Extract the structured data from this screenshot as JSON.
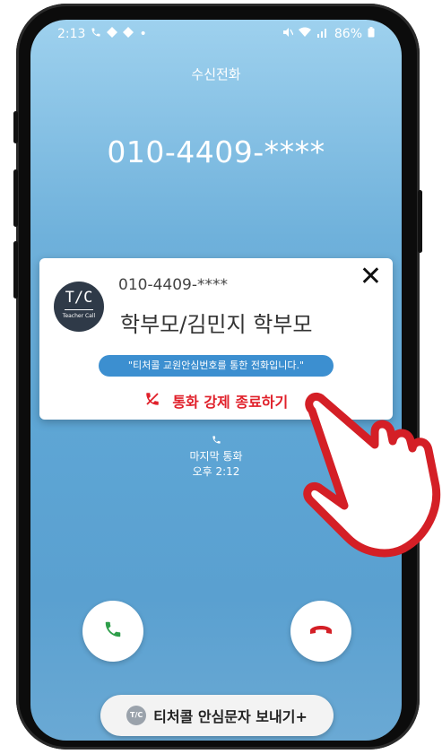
{
  "status_bar": {
    "time": "2:13",
    "left_icons": [
      "phone-icon",
      "diamond-icon",
      "diamond-icon",
      "dot"
    ],
    "battery": "86%"
  },
  "incoming": {
    "label": "수신전화",
    "number": "010-4409-****"
  },
  "popup": {
    "logo_text": "T/C",
    "logo_sub": "Teacher Call",
    "number": "010-4409-****",
    "name": "학부모/김민지 학부모",
    "notice": "\"티처콜 교원안심번호를 통한 전화입니다.\"",
    "force_end_label": "통화 강제 종료하기",
    "close_symbol": "✕"
  },
  "last_call": {
    "label": "마지막 통화",
    "time": "오후 2:12"
  },
  "bottom": {
    "mini_logo": "T/C",
    "label": "티처콜 안심문자 보내기+"
  },
  "colors": {
    "accent_blue": "#3c8fd0",
    "danger_red": "#e0202a",
    "accept_green": "#2e9e4a",
    "hand_red": "#d41f26"
  }
}
